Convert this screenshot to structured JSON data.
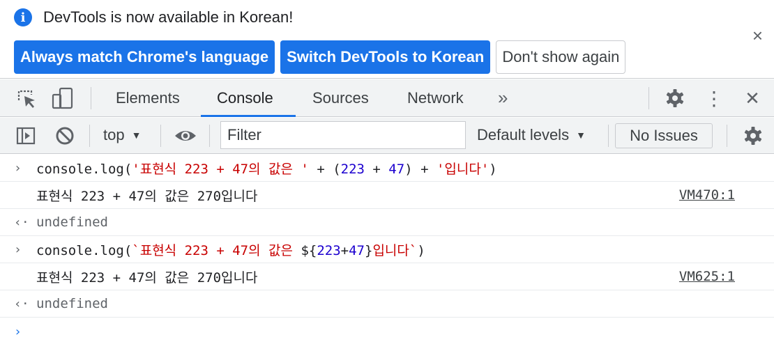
{
  "infobar": {
    "message": "DevTools is now available in Korean!",
    "info_icon": "info-icon",
    "buttons": {
      "match_language": "Always match Chrome's language",
      "switch_korean": "Switch DevTools to Korean",
      "dont_show": "Don't show again"
    },
    "close_icon": "close-icon",
    "close_glyph": "×"
  },
  "main_toolbar": {
    "tabs": [
      {
        "label": "Elements",
        "active": false
      },
      {
        "label": "Console",
        "active": true
      },
      {
        "label": "Sources",
        "active": false
      },
      {
        "label": "Network",
        "active": false
      }
    ],
    "more_tabs_glyph": "»",
    "close_glyph": "✕",
    "menu_glyph": "⋮",
    "icons": [
      "inspect-element-icon",
      "device-toolbar-icon",
      "more-tabs-icon",
      "settings-gear-icon",
      "kebab-menu-icon",
      "close-icon"
    ]
  },
  "console_toolbar": {
    "context": "top",
    "filter_placeholder": "Filter",
    "levels": "Default levels",
    "issues": "No Issues",
    "icons": [
      "sidebar-toggle-icon",
      "clear-console-icon",
      "eye-icon",
      "settings-gear-icon"
    ]
  },
  "console": {
    "rows": [
      {
        "type": "input",
        "gutter": "›",
        "parts": {
          "p1": "console.log(",
          "p2": "'표현식 223 + 47의 값은 '",
          "p3": " + (",
          "p4": "223",
          "p5": " + ",
          "p6": "47",
          "p7": ") + ",
          "p8": "'입니다'",
          "p9": ")"
        }
      },
      {
        "type": "log",
        "text": "표현식 223 + 47의 값은 270입니다",
        "source": "VM470:1"
      },
      {
        "type": "result",
        "gutter": "‹·",
        "text": "undefined"
      },
      {
        "type": "input",
        "gutter": "›",
        "parts": {
          "p1": "console.log(",
          "p2": "`표현식 223 + 47의 값은 ",
          "p3": "${",
          "p4": "223",
          "p5": "+",
          "p6": "47",
          "p7": "}",
          "p8": "입니다`",
          "p9": ")"
        }
      },
      {
        "type": "log",
        "text": "표현식 223 + 47의 값은 270입니다",
        "source": "VM625:1"
      },
      {
        "type": "result",
        "gutter": "‹·",
        "text": "undefined"
      }
    ],
    "prompt_glyph": "›"
  },
  "colors": {
    "accent": "#1a73e8",
    "string": "#c80000",
    "number": "#1c00cf",
    "toolbar_bg": "#f1f3f4"
  }
}
